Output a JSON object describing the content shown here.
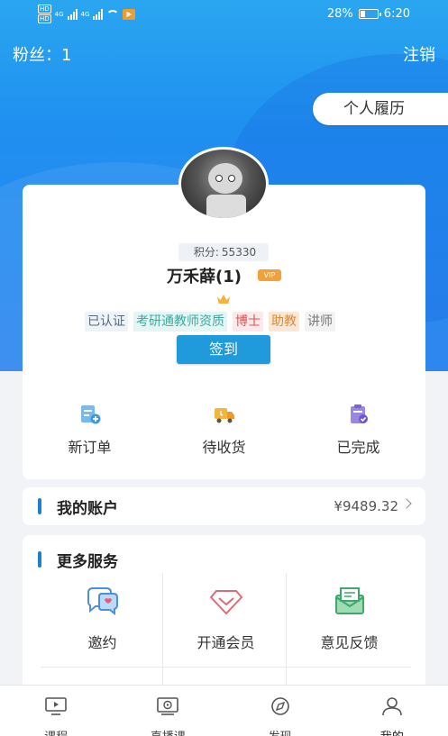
{
  "status_bar": {
    "hd1": "HD",
    "hd2": "HD",
    "net1": "4G",
    "net2": "4G",
    "app_icon": "▶",
    "battery": "28%",
    "time": "6:20"
  },
  "header": {
    "fans_label": "粉丝：1",
    "logout_label": "注销",
    "resume_label": "个人履历"
  },
  "profile": {
    "points_label": "积分:",
    "points_value": "55330",
    "name": "万禾薛(1)",
    "vip": "VIP",
    "tags": [
      "已认证",
      "考研通教师资质",
      "博士",
      "助教",
      "讲师"
    ],
    "checkin_label": "签到"
  },
  "orders": [
    {
      "label": "新订单",
      "icon": "new-order-icon"
    },
    {
      "label": "待收货",
      "icon": "delivery-truck-icon"
    },
    {
      "label": "已完成",
      "icon": "completed-clipboard-icon"
    }
  ],
  "account": {
    "title": "我的账户",
    "balance": "¥9489.32"
  },
  "services": {
    "title": "更多服务",
    "items": [
      {
        "label": "邀约",
        "icon": "chat-bubbles-icon"
      },
      {
        "label": "开通会员",
        "icon": "diamond-icon"
      },
      {
        "label": "意见反馈",
        "icon": "envelope-icon"
      }
    ]
  },
  "tabs": [
    {
      "label": "课程",
      "icon": "tv-icon"
    },
    {
      "label": "直播课",
      "icon": "live-screen-icon"
    },
    {
      "label": "发现",
      "icon": "compass-icon"
    },
    {
      "label": "我的",
      "icon": "person-icon",
      "active": true
    }
  ],
  "colors": {
    "primary": "#1f8ff0",
    "checkin": "#1f9bdc",
    "vip": "#f2a03a",
    "accent_bar": "#1f7fd0"
  }
}
